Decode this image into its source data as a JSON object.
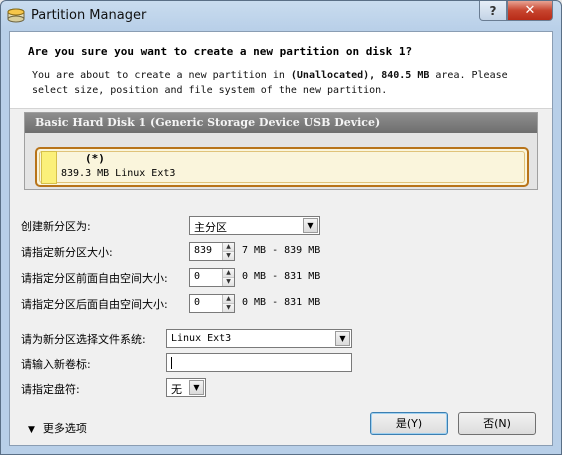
{
  "window": {
    "title": "Partition Manager",
    "help_label": "?",
    "close_label": "✕"
  },
  "header": {
    "question": "Are you sure you want to create a new partition on disk 1?",
    "desc_prefix": "You are about to create a new partition in ",
    "desc_bold": "(Unallocated), 840.5 MB",
    "desc_suffix": " area. Please select size, position and file system of the new partition."
  },
  "disk": {
    "title": "Basic Hard Disk 1 (Generic Storage Device USB Device)",
    "partition_marker": "(*)",
    "partition_info": "839.3 MB Linux Ext3",
    "swatch_color": "#fbf07a",
    "selection_color": "#b8741a"
  },
  "form": {
    "type_label": "创建新分区为:",
    "type_value": "主分区",
    "size_label": "请指定新分区大小:",
    "size_value": "839",
    "size_range": "7 MB - 839 MB",
    "before_label": "请指定分区前面自由空间大小:",
    "before_value": "0",
    "before_range": "0 MB - 831 MB",
    "after_label": "请指定分区后面自由空间大小:",
    "after_value": "0",
    "after_range": "0 MB - 831 MB",
    "fs_label": "请为新分区选择文件系统:",
    "fs_value": "Linux Ext3",
    "volume_label": "请输入新卷标:",
    "volume_value": "",
    "drive_label": "请指定盘符:",
    "drive_value": "无"
  },
  "footer": {
    "more_options": "更多选项",
    "yes_label": "是(Y)",
    "no_label": "否(N)"
  }
}
